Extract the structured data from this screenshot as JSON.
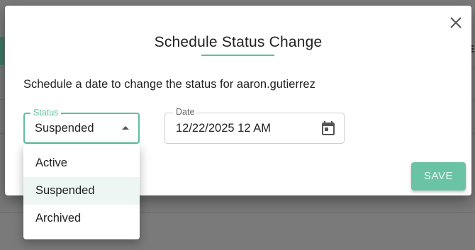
{
  "dialog": {
    "title": "Schedule Status Change",
    "description": "Schedule a date to change the status for aaron.gutierrez",
    "close_icon": "close-icon"
  },
  "status": {
    "label": "Status",
    "value": "Suspended",
    "options": [
      {
        "label": "Active",
        "selected": false
      },
      {
        "label": "Suspended",
        "selected": true
      },
      {
        "label": "Archived",
        "selected": false
      }
    ]
  },
  "date": {
    "label": "Date",
    "value": "12/22/2025 12 AM",
    "icon": "calendar-icon"
  },
  "actions": {
    "save_label": "SAVE"
  },
  "colors": {
    "accent": "#5fbf9f",
    "save_button": "#6bc3a6",
    "selected_option_bg": "#eef6f3"
  }
}
